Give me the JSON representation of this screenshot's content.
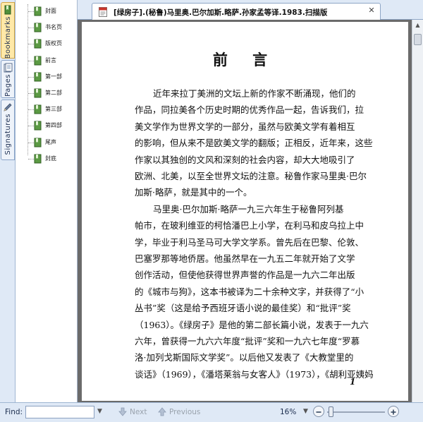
{
  "side_tabs": [
    {
      "label": "Bookmarks",
      "icon": "bookmarks-icon",
      "active": true
    },
    {
      "label": "Pages",
      "icon": "pages-icon",
      "active": false
    },
    {
      "label": "Signatures",
      "icon": "pen-icon",
      "active": false
    }
  ],
  "bookmarks": [
    {
      "label": "封面"
    },
    {
      "label": "书名页"
    },
    {
      "label": "版权页"
    },
    {
      "label": "前言"
    },
    {
      "label": "第一部"
    },
    {
      "label": "第二部"
    },
    {
      "label": "第三部"
    },
    {
      "label": "第四部"
    },
    {
      "label": "尾声"
    },
    {
      "label": "封底"
    }
  ],
  "document": {
    "tab_title": "[绿房子].(秘鲁)马里奥.巴尔加斯.略萨.孙家孟等译.1983.扫描版",
    "file_icon": "pdf-file-icon",
    "page": {
      "heading": "前  言",
      "lines": [
        "近年来拉丁美洲的文坛上新的作家不断涌现，他们的",
        "作品，同拉美各个历史时期的优秀作品一起，告诉我们，拉",
        "美文学作为世界文学的一部分，虽然与欧美文学有着相互",
        "的影响，但从来不是欧美文学的翻版；正相反，近年来，这些",
        "作家以其独创的文风和深刻的社会内容，却大大地吸引了",
        "欧洲、北美，以至全世界文坛的注意。秘鲁作家马里奥·巴尔",
        "加斯·略萨，就是其中的一个。",
        "马里奥·巴尔加斯·略萨一九三六年生于秘鲁阿列基",
        "帕市，在玻利维亚的柯恰潘巴上小学，在利马和皮乌拉上中",
        "学，毕业于利马圣马可大学文学系。曾先后在巴黎、伦敦、",
        "巴塞罗那等地侨居。他虽然早在一九五二年就开始了文学",
        "创作活动，但使他获得世界声誉的作品是一九六二年出版",
        "的《城市与狗》，这本书被译为二十余种文字，并获得了“小",
        "丛书”奖（这是给予西班牙语小说的最佳奖）和“批评”奖",
        "（1963）。《绿房子》是他的第二部长篇小说，发表于一九六",
        "六年，曾获得一九六六年度“批评”奖和一九六七年度“罗慕",
        "洛·加列戈斯国际文学奖”。以后他又发表了《大教堂里的",
        "谈话》（1969），《潘塔莱翁与女客人》（1973），《胡利亚姨妈"
      ],
      "page_number": "1"
    }
  },
  "findbar": {
    "label": "Find:",
    "input_value": "",
    "next_label": "Next",
    "previous_label": "Previous",
    "zoom": "16%",
    "zoom_level": 0.06
  }
}
